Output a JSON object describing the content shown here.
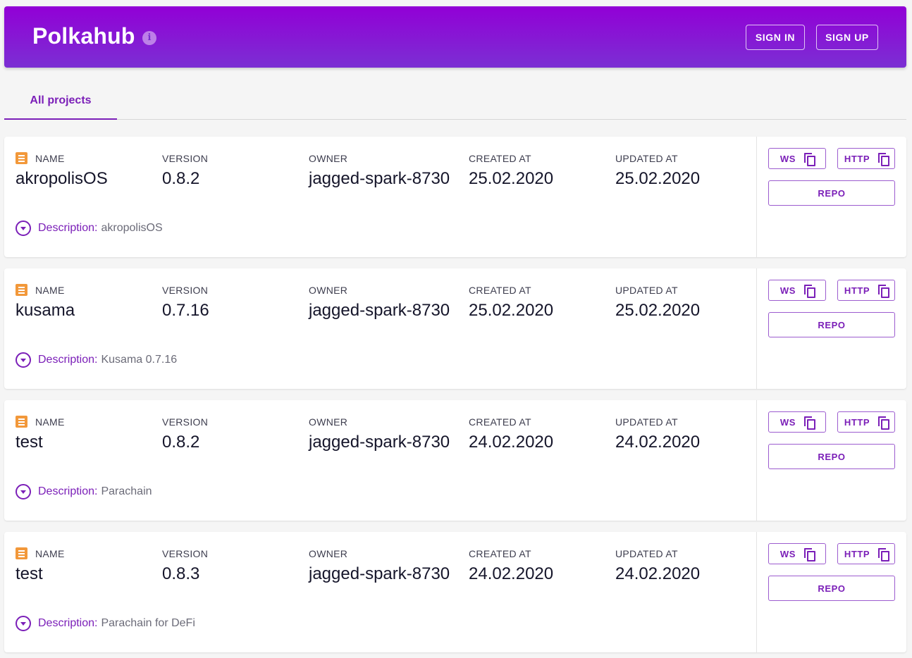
{
  "header": {
    "title": "Polkahub",
    "info_icon": "info-icon",
    "sign_in": "SIGN IN",
    "sign_up": "SIGN UP"
  },
  "tabs": [
    {
      "label": "All projects",
      "active": true
    }
  ],
  "labels": {
    "name": "NAME",
    "version": "VERSION",
    "owner": "OWNER",
    "created": "CREATED AT",
    "updated": "UPDATED AT",
    "description": "Description:",
    "ws": "WS",
    "http": "HTTP",
    "repo": "REPO"
  },
  "projects": [
    {
      "name": "akropolisOS",
      "version": "0.8.2",
      "owner": "jagged-spark-8730",
      "created": "25.02.2020",
      "updated": "25.02.2020",
      "description": "akropolisOS"
    },
    {
      "name": "kusama",
      "version": "0.7.16",
      "owner": "jagged-spark-8730",
      "created": "25.02.2020",
      "updated": "25.02.2020",
      "description": "Kusama 0.7.16"
    },
    {
      "name": "test",
      "version": "0.8.2",
      "owner": "jagged-spark-8730",
      "created": "24.02.2020",
      "updated": "24.02.2020",
      "description": "Parachain"
    },
    {
      "name": "test",
      "version": "0.8.3",
      "owner": "jagged-spark-8730",
      "created": "24.02.2020",
      "updated": "24.02.2020",
      "description": "Parachain for DeFi"
    }
  ],
  "colors": {
    "accent": "#7b1fb8",
    "header_gradient_start": "#9200d6",
    "header_gradient_end": "#7b2fd3",
    "doc_icon": "#f2983a"
  }
}
